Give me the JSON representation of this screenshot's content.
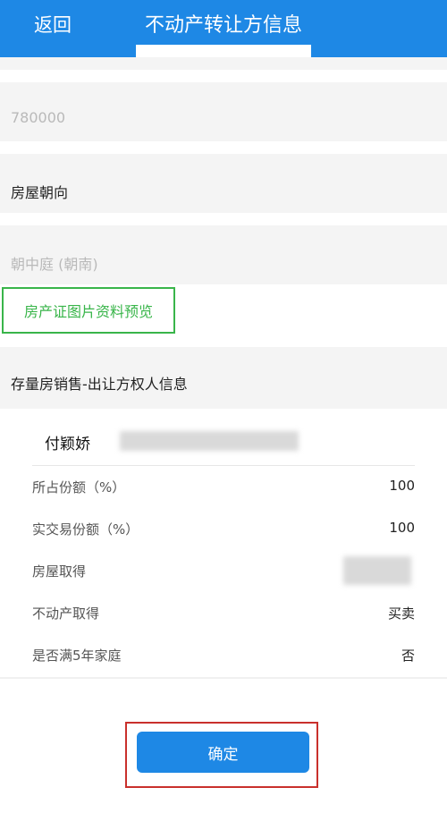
{
  "header": {
    "back_label": "返回",
    "title": "不动产转让方信息",
    "accent": "#1e88e5"
  },
  "fields": [
    {
      "text": "780000",
      "kind": "value"
    },
    {
      "text": "房屋朝向",
      "kind": "label"
    },
    {
      "text": "朝中庭 (朝南)",
      "kind": "value"
    }
  ],
  "preview_button": "房产证图片资料预览",
  "section_title": "存量房销售-出让方权人信息",
  "owner": {
    "name": "付颖娇",
    "rows": [
      {
        "key": "所占份额（%）",
        "value": "100"
      },
      {
        "key": "实交易份额（%）",
        "value": "100"
      },
      {
        "key": "房屋取得",
        "value": ""
      },
      {
        "key": "不动产取得",
        "value": "买卖"
      },
      {
        "key": "是否满5年家庭",
        "value": "否"
      }
    ]
  },
  "confirm_button": "确定"
}
